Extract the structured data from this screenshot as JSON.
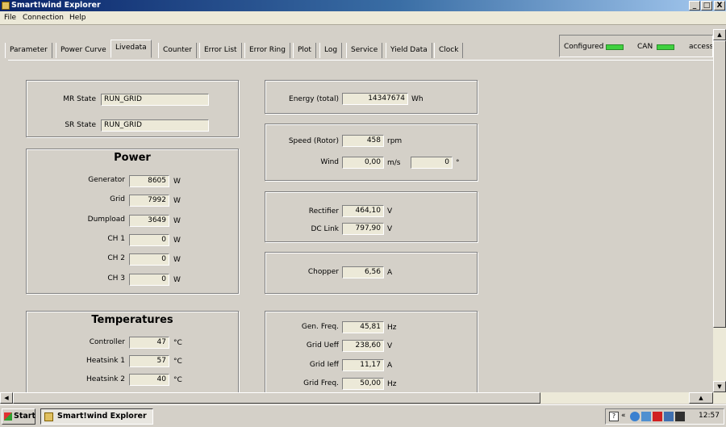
{
  "window": {
    "title": "Smart!wind Explorer",
    "min": "_",
    "max": "□",
    "close": "X"
  },
  "menu": [
    "File",
    "Connection",
    "Help"
  ],
  "tabs": [
    "Parameter",
    "Power Curve",
    "Livedata",
    "Counter",
    "Error List",
    "Error Ring",
    "Plot",
    "Log",
    "Service",
    "Yield Data",
    "Clock"
  ],
  "status": {
    "configured": "Configured",
    "can": "CAN",
    "access": "access_"
  },
  "state": {
    "mr_label": "MR State",
    "mr_value": "RUN_GRID",
    "sr_label": "SR State",
    "sr_value": "RUN_GRID"
  },
  "power": {
    "title": "Power",
    "rows": [
      {
        "label": "Generator",
        "value": "8605",
        "unit": "W"
      },
      {
        "label": "Grid",
        "value": "7992",
        "unit": "W"
      },
      {
        "label": "Dumpload",
        "value": "3649",
        "unit": "W"
      },
      {
        "label": "CH 1",
        "value": "0",
        "unit": "W"
      },
      {
        "label": "CH 2",
        "value": "0",
        "unit": "W"
      },
      {
        "label": "CH 3",
        "value": "0",
        "unit": "W"
      }
    ]
  },
  "temps": {
    "title": "Temperatures",
    "rows": [
      {
        "label": "Controller",
        "value": "47",
        "unit": "°C"
      },
      {
        "label": "Heatsink 1",
        "value": "57",
        "unit": "°C"
      },
      {
        "label": "Heatsink 2",
        "value": "40",
        "unit": "°C"
      }
    ]
  },
  "energy": {
    "label": "Energy (total)",
    "value": "14347674",
    "unit": "Wh"
  },
  "speed": {
    "label": "Speed (Rotor)",
    "value": "458",
    "unit": "rpm",
    "wind_label": "Wind",
    "wind_value": "0,00",
    "wind_unit": "m/s",
    "dir_value": "0",
    "dir_unit": "°"
  },
  "dc": {
    "rect_label": "Rectifier",
    "rect_value": "464,10",
    "rect_unit": "V",
    "link_label": "DC Link",
    "link_value": "797,90",
    "link_unit": "V"
  },
  "chopper": {
    "label": "Chopper",
    "value": "6,56",
    "unit": "A"
  },
  "grid": {
    "rows": [
      {
        "label": "Gen. Freq.",
        "value": "45,81",
        "unit": "Hz"
      },
      {
        "label": "Grid Ueff",
        "value": "238,60",
        "unit": "V"
      },
      {
        "label": "Grid Ieff",
        "value": "11,17",
        "unit": "A"
      },
      {
        "label": "Grid Freq.",
        "value": "50,00",
        "unit": "Hz"
      }
    ]
  },
  "taskbar": {
    "start": "Start",
    "item": "Smart!wind Explorer",
    "clock": "12:57",
    "tray_arrows": "«"
  }
}
